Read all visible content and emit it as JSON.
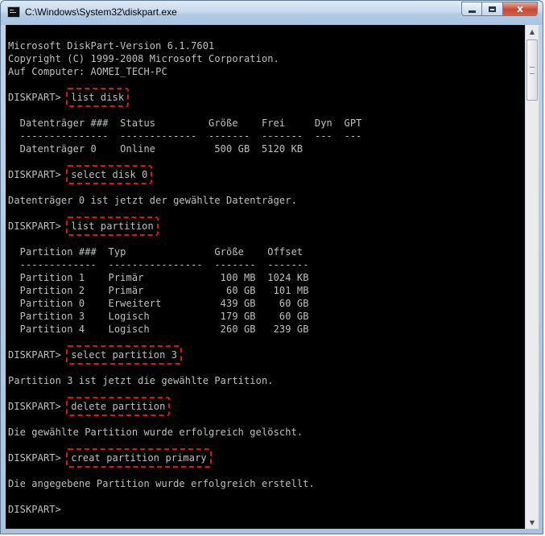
{
  "window": {
    "title": "C:\\Windows\\System32\\diskpart.exe",
    "controls": {
      "minimize": "",
      "maximize": "",
      "close": "x"
    }
  },
  "console": {
    "lines": [
      {
        "text": "Microsoft DiskPart-Version 6.1.7601"
      },
      {
        "text": "Copyright (C) 1999-2008 Microsoft Corporation."
      },
      {
        "text": "Auf Computer: AOMEI_TECH-PC"
      },
      {
        "text": ""
      },
      {
        "prompt": "DISKPART> ",
        "command": "list disk"
      },
      {
        "text": ""
      },
      {
        "text": "  Datenträger ###  Status         Größe    Frei     Dyn  GPT"
      },
      {
        "text": "  ---------------  -------------  -------  -------  ---  ---"
      },
      {
        "text": "  Datenträger 0    Online          500 GB  5120 KB"
      },
      {
        "text": ""
      },
      {
        "prompt": "DISKPART> ",
        "command": "select disk 0"
      },
      {
        "text": ""
      },
      {
        "text": "Datenträger 0 ist jetzt der gewählte Datenträger."
      },
      {
        "text": ""
      },
      {
        "prompt": "DISKPART> ",
        "command": "list partition"
      },
      {
        "text": ""
      },
      {
        "text": "  Partition ###  Typ               Größe    Offset"
      },
      {
        "text": "  -------------  ----------------  -------  -------"
      },
      {
        "text": "  Partition 1    Primär             100 MB  1024 KB"
      },
      {
        "text": "  Partition 2    Primär              60 GB   101 MB"
      },
      {
        "text": "  Partition 0    Erweitert          439 GB    60 GB"
      },
      {
        "text": "  Partition 3    Logisch            179 GB    60 GB"
      },
      {
        "text": "  Partition 4    Logisch            260 GB   239 GB"
      },
      {
        "text": ""
      },
      {
        "prompt": "DISKPART> ",
        "command": "select partition 3"
      },
      {
        "text": ""
      },
      {
        "text": "Partition 3 ist jetzt die gewählte Partition."
      },
      {
        "text": ""
      },
      {
        "prompt": "DISKPART> ",
        "command": "delete partition"
      },
      {
        "text": ""
      },
      {
        "text": "Die gewählte Partition wurde erfolgreich gelöscht."
      },
      {
        "text": ""
      },
      {
        "prompt": "DISKPART> ",
        "command": "creat partition primary"
      },
      {
        "text": ""
      },
      {
        "text": "Die angegebene Partition wurde erfolgreich erstellt."
      },
      {
        "text": ""
      },
      {
        "prompt": "DISKPART> ",
        "command": ""
      }
    ]
  },
  "colors": {
    "console_bg": "#000000",
    "console_fg": "#c0c0c0",
    "highlight": "#d9141c"
  },
  "icons": {
    "app": "console-icon",
    "scroll_up": "arrow-up-icon",
    "scroll_down": "arrow-down-icon"
  }
}
